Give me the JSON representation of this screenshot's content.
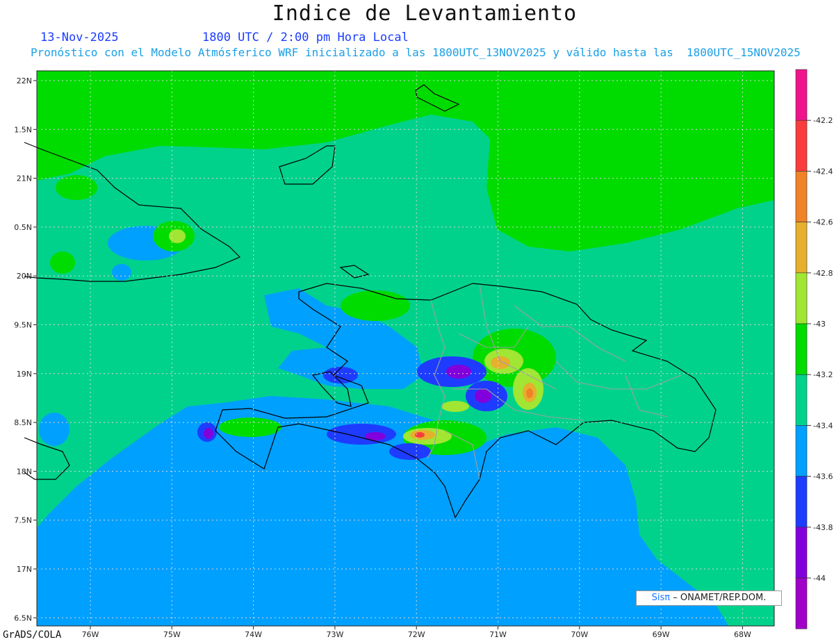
{
  "title": "Indice de Levantamiento",
  "date": "13-Nov-2025",
  "time": "1800 UTC / 2:00 pm Hora Local",
  "subtitle": "Pronóstico con el Modelo Atmósferico WRF inicializado a las 1800UTC_13NOV2025 y válido hasta las  1800UTC_15NOV2025",
  "footer": "GrADS/COLA",
  "credit": {
    "logo": "Sisπ",
    "text": "– ONAMET/REP.DOM."
  },
  "lat_labels": [
    "22N",
    "1.5N",
    "21N",
    "0.5N",
    "20N",
    "9.5N",
    "19N",
    "8.5N",
    "18N",
    "7.5N",
    "17N",
    "6.5N"
  ],
  "lon_labels": [
    "76W",
    "75W",
    "74W",
    "73W",
    "72W",
    "71W",
    "70W",
    "69W",
    "68W"
  ],
  "colorbar": {
    "labels": [
      "-42.2",
      "-42.4",
      "-42.6",
      "-42.8",
      "-43",
      "-43.2",
      "-43.4",
      "-43.6",
      "-43.8",
      "-44"
    ],
    "colors": [
      "#f0148c",
      "#fa3c3c",
      "#f08228",
      "#e6af2d",
      "#a0e632",
      "#00dc00",
      "#00d28c",
      "#00a0ff",
      "#1e3cff",
      "#8200dc",
      "#a000c8"
    ]
  }
}
